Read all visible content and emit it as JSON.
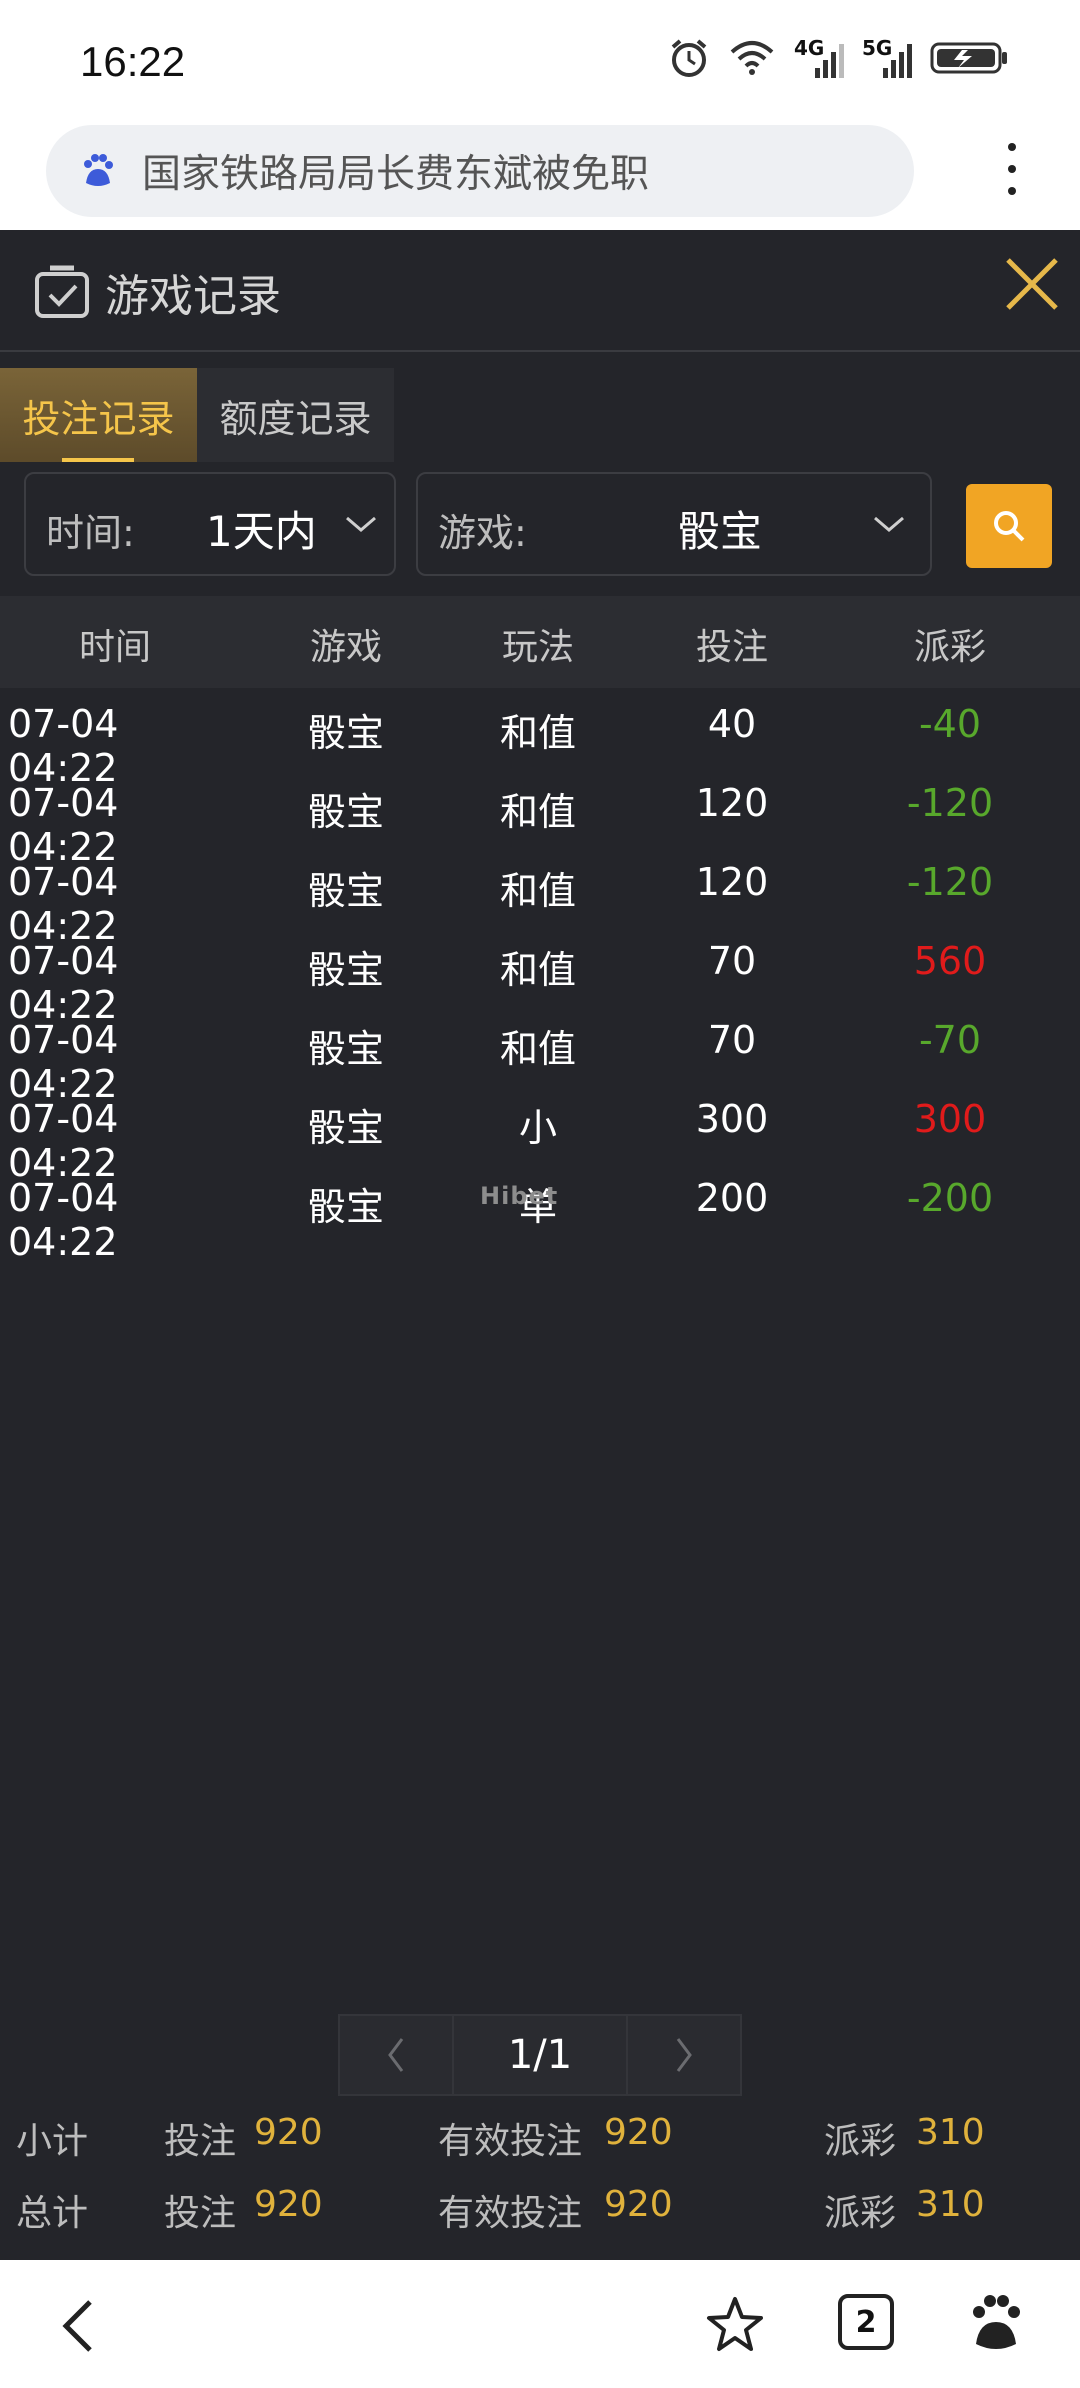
{
  "status": {
    "time": "16:22",
    "net1": "4G",
    "net2": "5G"
  },
  "browser": {
    "query": "国家铁路局局长费东斌被免职"
  },
  "header": {
    "title": "游戏记录"
  },
  "tabs": [
    {
      "label": "投注记录"
    },
    {
      "label": "额度记录"
    }
  ],
  "filters": {
    "time_label": "时间:",
    "time_value": "1天内",
    "game_label": "游戏:",
    "game_value": "骰宝"
  },
  "table": {
    "headers": [
      "时间",
      "游戏",
      "玩法",
      "投注",
      "派彩"
    ],
    "rows": [
      {
        "time": "07-04 04:22",
        "game": "骰宝",
        "play": "和值",
        "bet": "40",
        "payout": "-40",
        "sign": "neg"
      },
      {
        "time": "07-04 04:22",
        "game": "骰宝",
        "play": "和值",
        "bet": "120",
        "payout": "-120",
        "sign": "neg"
      },
      {
        "time": "07-04 04:22",
        "game": "骰宝",
        "play": "和值",
        "bet": "120",
        "payout": "-120",
        "sign": "neg"
      },
      {
        "time": "07-04 04:22",
        "game": "骰宝",
        "play": "和值",
        "bet": "70",
        "payout": "560",
        "sign": "pos"
      },
      {
        "time": "07-04 04:22",
        "game": "骰宝",
        "play": "和值",
        "bet": "70",
        "payout": "-70",
        "sign": "neg"
      },
      {
        "time": "07-04 04:22",
        "game": "骰宝",
        "play": "小",
        "bet": "300",
        "payout": "300",
        "sign": "pos"
      },
      {
        "time": "07-04 04:22",
        "game": "骰宝",
        "play": "单",
        "bet": "200",
        "payout": "-200",
        "sign": "neg"
      }
    ]
  },
  "watermark": "Hibet",
  "pager": {
    "text": "1/1"
  },
  "summary": {
    "subtotal": {
      "label": "小计",
      "bet_label": "投注",
      "bet": "920",
      "valid_label": "有效投注",
      "valid": "920",
      "payout_label": "派彩",
      "payout": "310"
    },
    "total": {
      "label": "总计",
      "bet_label": "投注",
      "bet": "920",
      "valid_label": "有效投注",
      "valid": "920",
      "payout_label": "派彩",
      "payout": "310"
    }
  },
  "nav": {
    "tab_count": "2"
  },
  "colors": {
    "accent": "#f1a524",
    "gold_text": "#e0b23c",
    "loss": "#58a82c",
    "win": "#e01b1b",
    "panel": "#24252a"
  }
}
